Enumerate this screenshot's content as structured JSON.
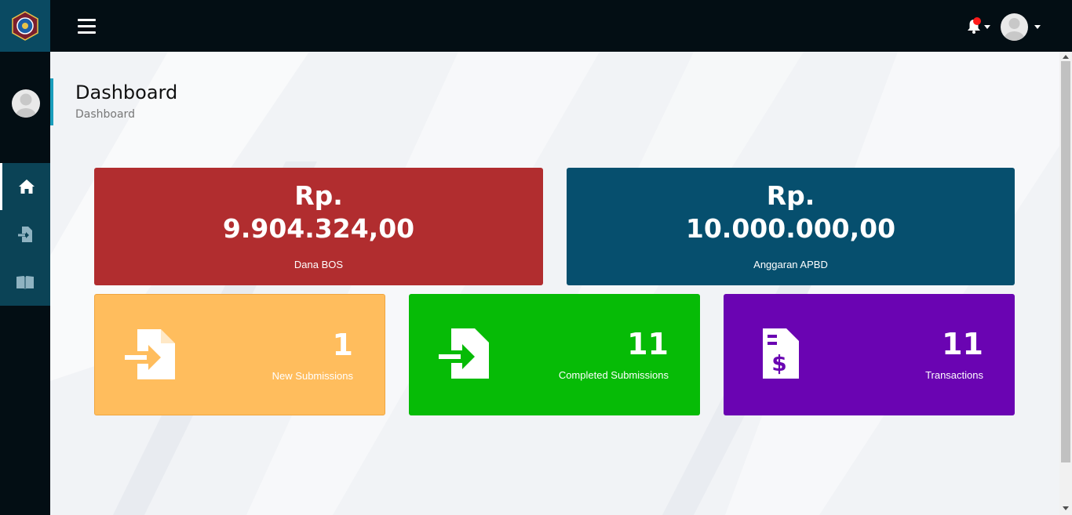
{
  "header": {
    "logo_name": "school-logo",
    "notification_icon": "bell-icon",
    "profile_icon": "user-avatar-icon"
  },
  "sidebar": {
    "items": [
      {
        "icon": "home-icon",
        "active": true
      },
      {
        "icon": "sign-in-file-icon",
        "active": false
      },
      {
        "icon": "open-book-icon",
        "active": false
      }
    ]
  },
  "page": {
    "title": "Dashboard",
    "breadcrumb": "Dashboard"
  },
  "summary_cards": [
    {
      "currency": "Rp.",
      "amount": "9.904.324,00",
      "label": "Dana BOS",
      "color": "#b12d2f"
    },
    {
      "currency": "Rp.",
      "amount": "10.000.000,00",
      "label": "Anggaran APBD",
      "color": "#064f6e"
    }
  ],
  "stat_cards": [
    {
      "count": "1",
      "label": "New Submissions",
      "icon": "file-import-icon",
      "color": "#ffbd5d"
    },
    {
      "count": "11",
      "label": "Completed Submissions",
      "icon": "file-import-icon",
      "color": "#06bb06"
    },
    {
      "count": "11",
      "label": "Transactions",
      "icon": "file-invoice-dollar-icon",
      "color": "#6a04b2"
    }
  ],
  "colors": {
    "topbar": "#030e14",
    "sidebar_nav": "#0b4356",
    "accent": "#1a9dbb",
    "background": "#f1f3f6"
  }
}
